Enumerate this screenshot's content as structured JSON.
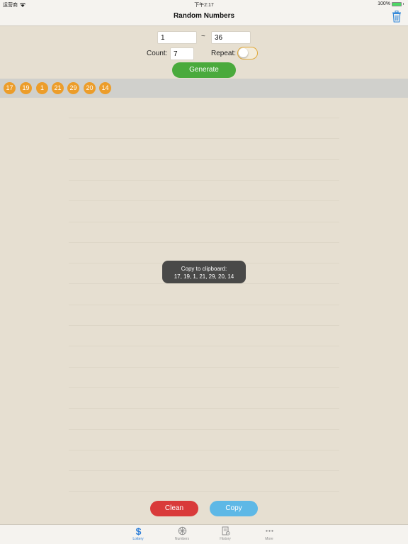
{
  "status_bar": {
    "carrier": "运营商",
    "time": "下午2:17",
    "battery": "100%"
  },
  "nav": {
    "title": "Random Numbers",
    "trash_icon": "trash-icon"
  },
  "form": {
    "min_value": "1",
    "range_separator": "~",
    "max_value": "36",
    "count_label": "Count:",
    "count_value": "7",
    "repeat_label": "Repeat:",
    "repeat_on": false,
    "generate_label": "Generate"
  },
  "results": [
    "17",
    "19",
    "1",
    "21",
    "29",
    "20",
    "14"
  ],
  "toast": {
    "title": "Copy to clipboard:",
    "numbers": "17, 19, 1, 21, 29, 20, 14"
  },
  "actions": {
    "clean_label": "Clean",
    "copy_label": "Copy"
  },
  "tabs": [
    {
      "label": "Lottery",
      "icon": "dollar-icon",
      "active": true
    },
    {
      "label": "Numbers",
      "icon": "wheel-icon",
      "active": false
    },
    {
      "label": "History",
      "icon": "history-icon",
      "active": false
    },
    {
      "label": "More",
      "icon": "more-icon",
      "active": false
    }
  ],
  "colors": {
    "background": "#e6dfd1",
    "ball": "#ec9d2a",
    "generate": "#4aaa3c",
    "clean": "#d93a3a",
    "copy": "#5eb8e6",
    "active_tab": "#2f7fd8"
  }
}
